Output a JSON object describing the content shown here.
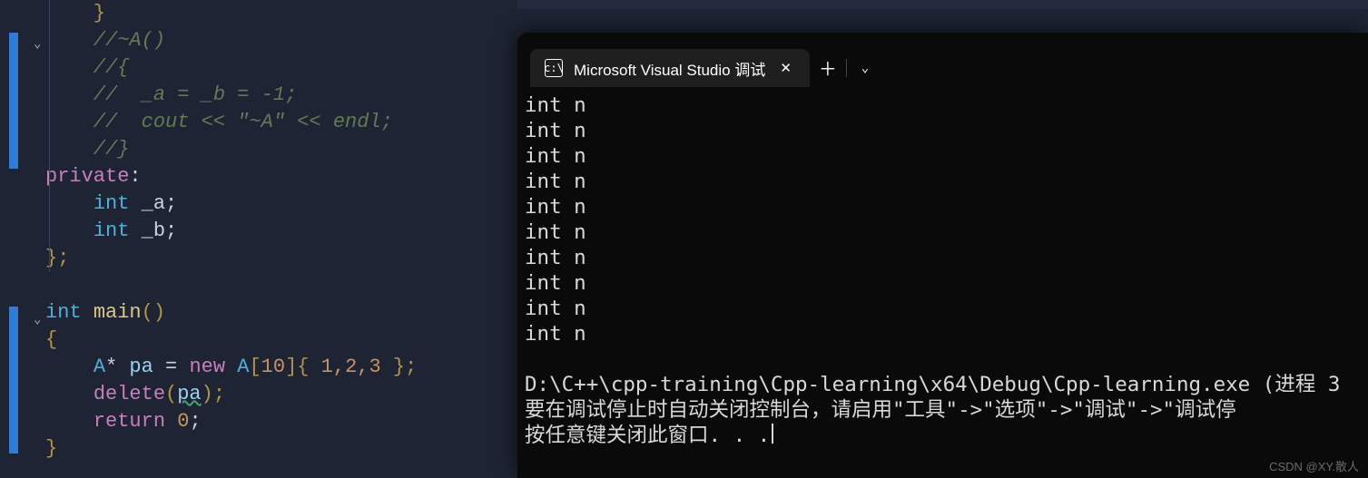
{
  "editor": {
    "lines": {
      "l0": "    }",
      "l1": "    //~A()",
      "l2": "    //{",
      "l3": "    //  _a = _b = -1;",
      "l4": "    //  cout << \"~A\" << endl;",
      "l5": "    //}",
      "l6_kw": "private",
      "l7_type": "int",
      "l7_var": " _a",
      "l8_type": "int",
      "l8_var": " _b",
      "main_type": "int",
      "main_name": "main",
      "arr_type": "A",
      "arr_var": "pa",
      "arr_kw": "new",
      "arr_cls": "A",
      "arr_n": "10",
      "arr_vals": "1,2,3",
      "del": "delete",
      "del_arg": "pa",
      "ret": "return",
      "ret_v": "0"
    }
  },
  "terminal": {
    "tab_title": "Microsoft Visual Studio 调试",
    "output_line": "int n",
    "output_count": 10,
    "footer_path": "D:\\C++\\cpp-training\\Cpp-learning\\x64\\Debug\\Cpp-learning.exe (进程 3",
    "footer_hint": "要在调试停止时自动关闭控制台，请启用\"工具\"->\"选项\"->\"调试\"->\"调试停",
    "footer_close": "按任意键关闭此窗口. . ."
  },
  "watermark": "CSDN @XY.散人"
}
